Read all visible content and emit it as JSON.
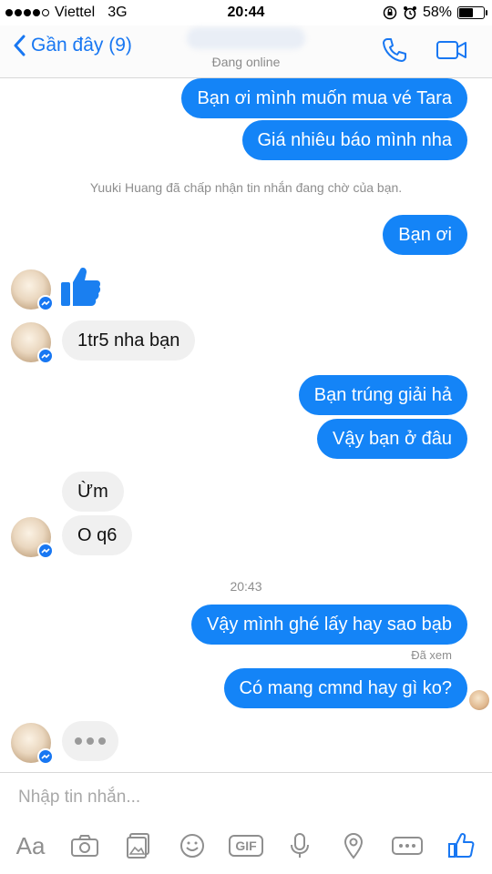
{
  "status_bar": {
    "carrier": "Viettel",
    "network": "3G",
    "time": "20:44",
    "battery_text": "58%",
    "battery_level": 0.58
  },
  "header": {
    "back_label": "Gần đây (9)",
    "presence": "Đang online"
  },
  "messages": {
    "out_1": "Bạn ơi mình muốn mua vé Tara",
    "out_2": "Giá nhiêu báo mình nha",
    "system_note": "Yuuki Huang đã chấp nhận tin nhắn đang chờ của bạn.",
    "out_3": "Bạn ơi",
    "in_1": "1tr5 nha bạn",
    "out_4": "Bạn trúng giải hả",
    "out_5": "Vậy bạn ở đâu",
    "in_2": "Ừm",
    "in_3": "O q6",
    "timestamp": "20:43",
    "out_6": "Vậy mình ghé lấy hay sao bạb",
    "seen_label": "Đã xem",
    "out_7": "Có mang cmnd hay gì ko?"
  },
  "composer": {
    "placeholder": "Nhập tin nhắn...",
    "text_tool_label": "Aa",
    "gif_label": "GIF"
  },
  "colors": {
    "accent": "#1877f2",
    "outgoing_bubble": "#1484f7",
    "incoming_bubble": "#f0f0f0"
  },
  "icons": {
    "header": [
      "chevron-left-icon",
      "phone-icon",
      "video-icon"
    ],
    "toolbar": [
      "text-icon",
      "camera-icon",
      "gallery-icon",
      "emoji-icon",
      "gif-icon",
      "microphone-icon",
      "location-icon",
      "more-icon",
      "like-icon"
    ]
  }
}
